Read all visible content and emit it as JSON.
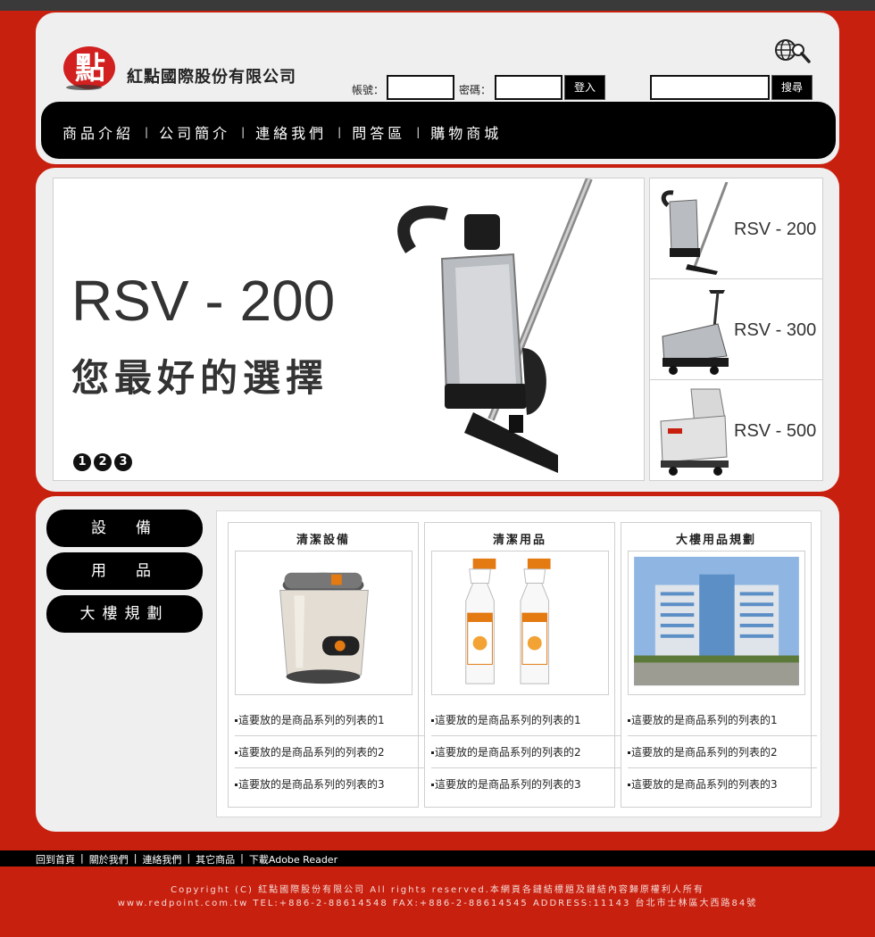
{
  "header": {
    "company_name": "紅點國際股份有限公司",
    "logo_char": "點",
    "account_label": "帳號：",
    "password_label": "密碼：",
    "login_button": "登入",
    "search_button": "搜尋",
    "account_value": "",
    "password_value": "",
    "search_value": ""
  },
  "nav": {
    "items": [
      "商品介紹",
      "公司簡介",
      "連絡我們",
      "問答區",
      "購物商城"
    ]
  },
  "banner": {
    "title": "RSV - 200",
    "subtitle": "您最好的選擇",
    "pager": [
      "1",
      "2",
      "3"
    ],
    "thumbs": [
      {
        "label": "RSV - 200"
      },
      {
        "label": "RSV - 300"
      },
      {
        "label": "RSV - 500"
      }
    ]
  },
  "sidebar": {
    "items": [
      "設　備",
      "用　品",
      "大樓規劃"
    ]
  },
  "categories": [
    {
      "title": "清潔設備",
      "list": [
        "這要放的是商品系列的列表的1",
        "這要放的是商品系列的列表的2",
        "這要放的是商品系列的列表的3"
      ]
    },
    {
      "title": "清潔用品",
      "list": [
        "這要放的是商品系列的列表的1",
        "這要放的是商品系列的列表的2",
        "這要放的是商品系列的列表的3"
      ]
    },
    {
      "title": "大樓用品規劃",
      "list": [
        "這要放的是商品系列的列表的1",
        "這要放的是商品系列的列表的2",
        "這要放的是商品系列的列表的3"
      ]
    }
  ],
  "footer": {
    "links": [
      "回到首頁",
      "關於我們",
      "連絡我們",
      "其它商品",
      "下載Adobe Reader"
    ],
    "separator": "|",
    "copyright_line1": "Copyright (C) 紅點國際股份有限公司 All rights reserved.本網頁各鏈結標題及鏈結內容歸原權利人所有",
    "copyright_line2": "www.redpoint.com.tw TEL:+886-2-88614548 FAX:+886-2-88614545 ADDRESS:11143 台北市士林區大西路84號"
  },
  "colors": {
    "brand_red": "#c8200f",
    "panel_gray": "#efefef",
    "nav_black": "#000000"
  }
}
